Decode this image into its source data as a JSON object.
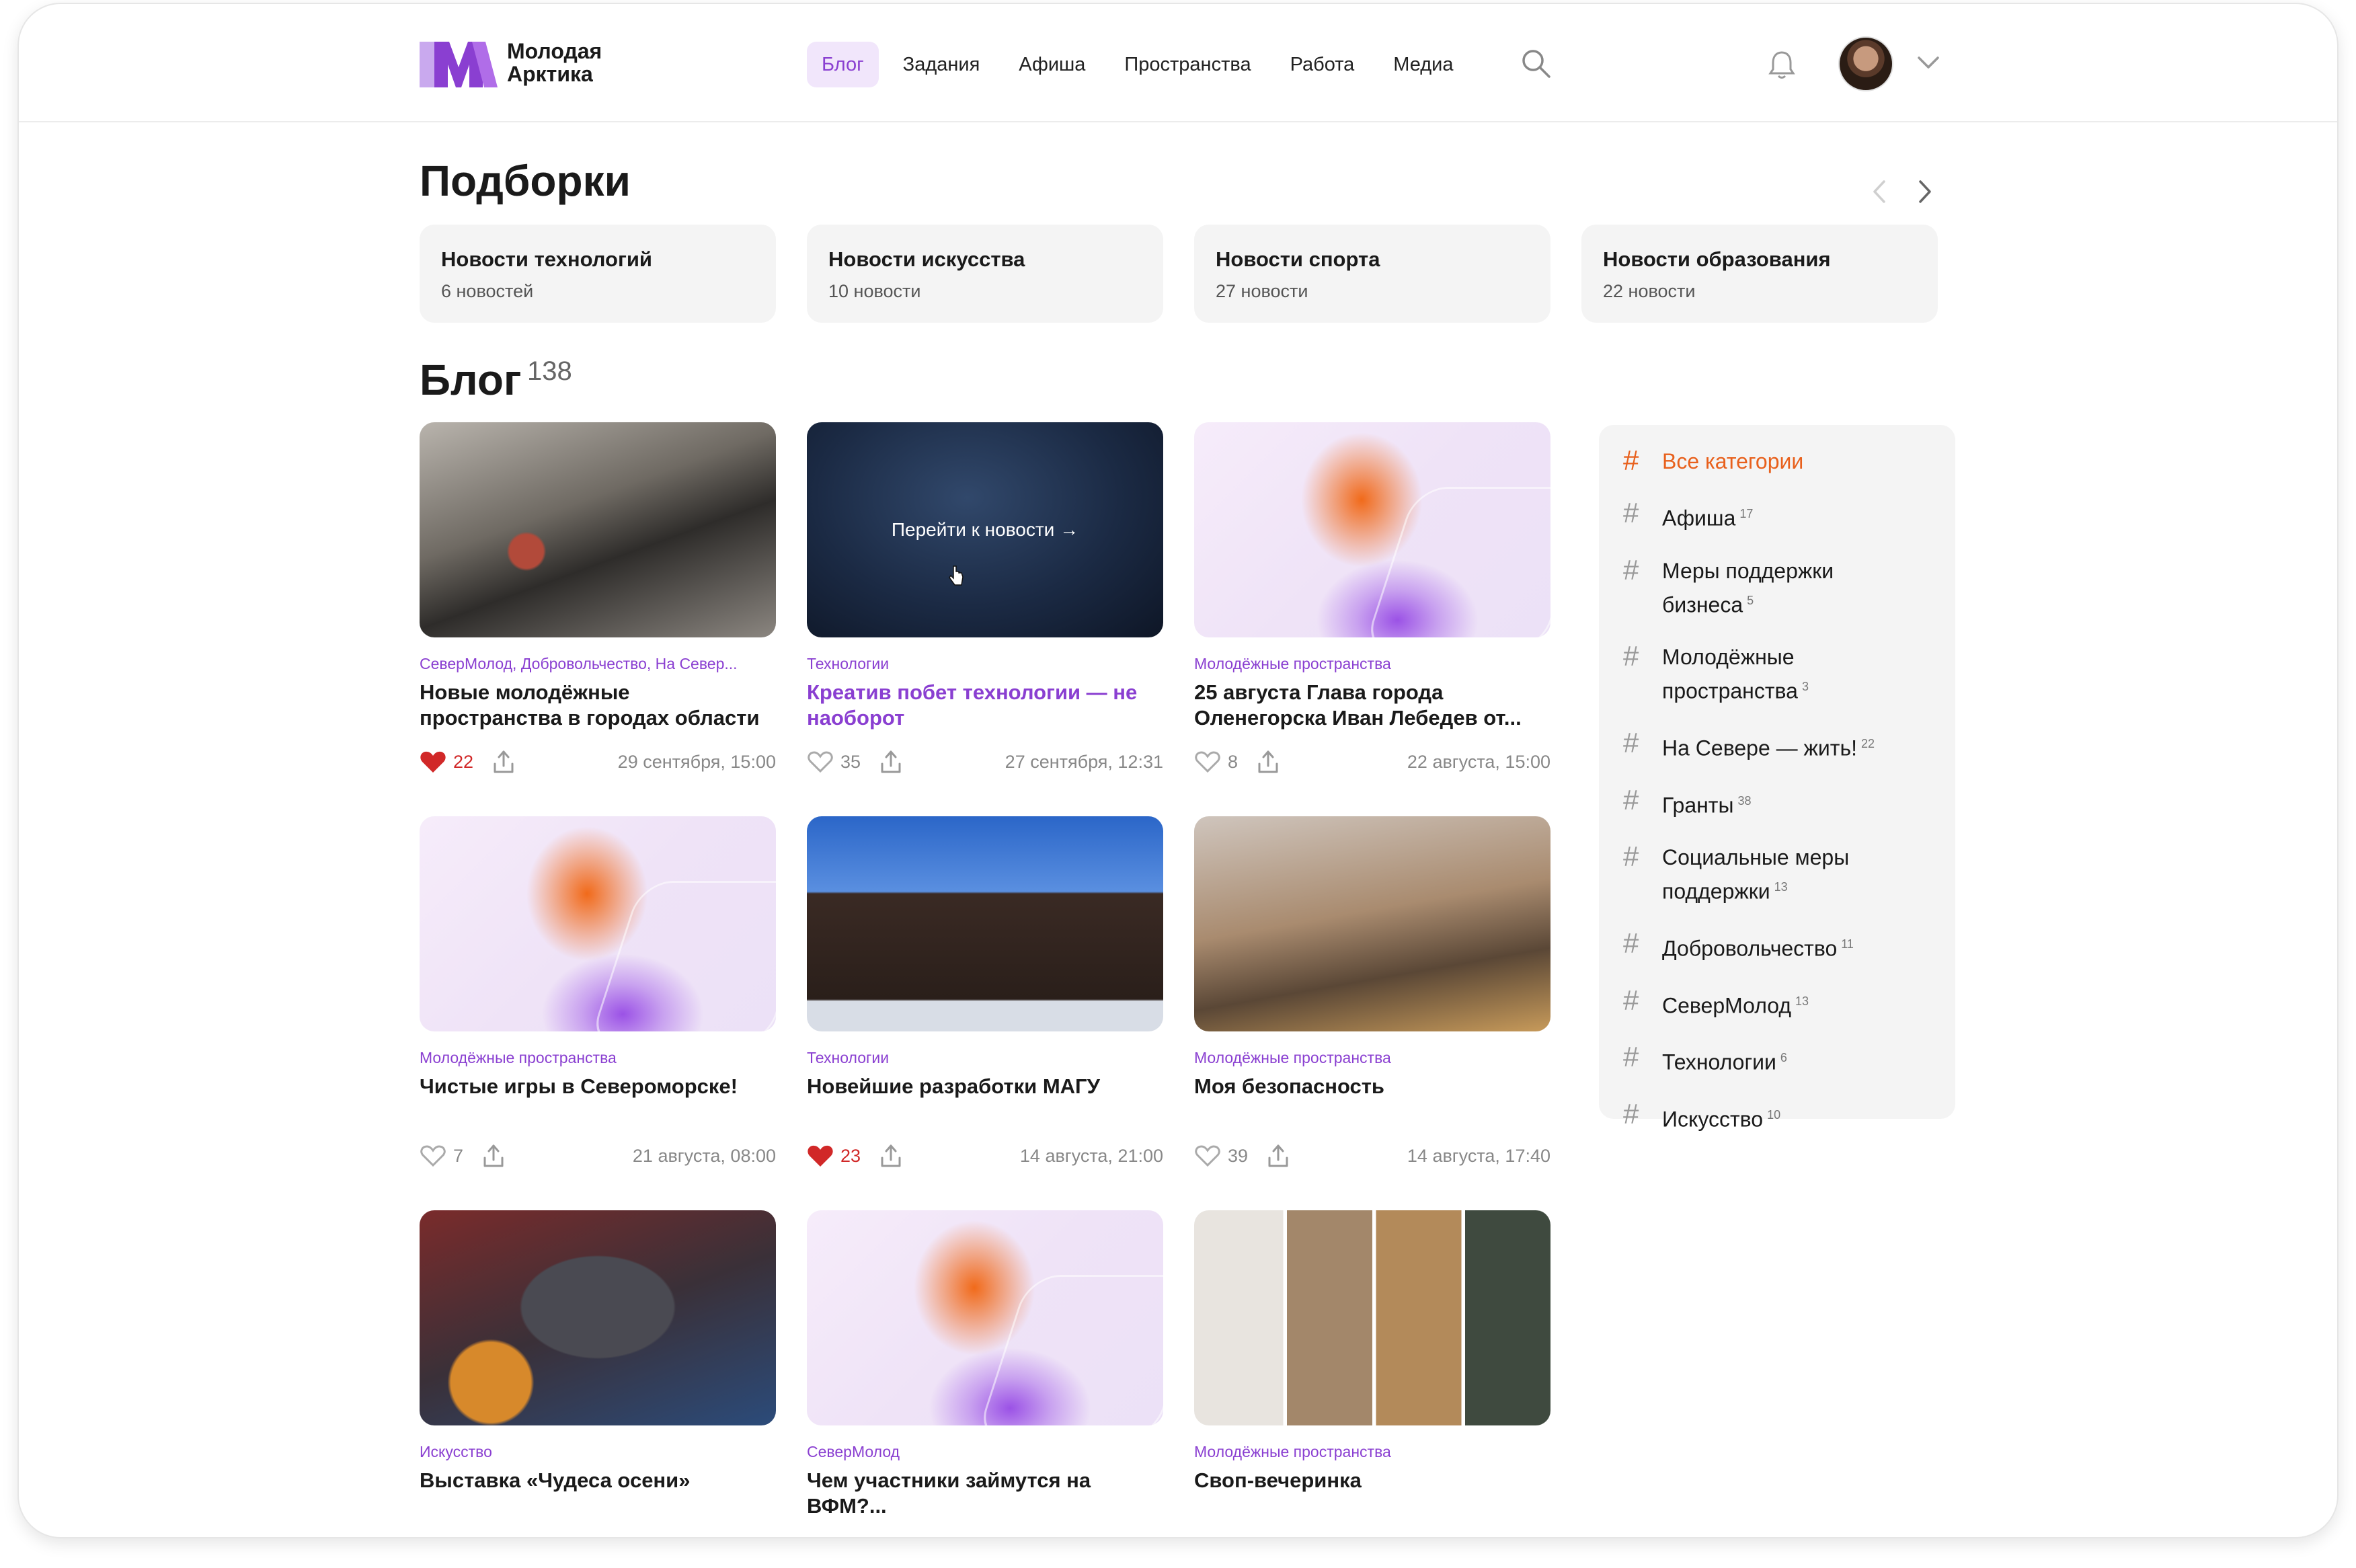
{
  "header": {
    "logo_line1": "Молодая",
    "logo_line2": "Арктика",
    "nav": [
      "Блог",
      "Задания",
      "Афиша",
      "Пространства",
      "Работа",
      "Медиа"
    ]
  },
  "collections": {
    "title": "Подборки",
    "items": [
      {
        "name": "Новости технологий",
        "count": "6 новостей"
      },
      {
        "name": "Новости искусства",
        "count": "10 новости"
      },
      {
        "name": "Новости спорта",
        "count": "27 новости"
      },
      {
        "name": "Новости образования",
        "count": "22 новости"
      }
    ]
  },
  "blog": {
    "title": "Блог",
    "count": "138",
    "hover_text": "Перейти к новости →",
    "cards": [
      {
        "tags": "СеверМолод, Добровольчество, На Север...",
        "title": "Новые молодёжные пространства в городах области",
        "likes": "22",
        "liked": true,
        "date": "29 сентября, 15:00"
      },
      {
        "tags": "Технологии",
        "title": "Креатив побет технологии — не наоборот",
        "likes": "35",
        "liked": false,
        "date": "27 сентября, 12:31"
      },
      {
        "tags": "Молодёжные пространства",
        "title": "25 августа Глава города Оленегорска Иван Лебедев от...",
        "likes": "8",
        "liked": false,
        "date": "22 августа, 15:00"
      },
      {
        "tags": "Молодёжные пространства",
        "title": "Чистые игры в Североморске!",
        "likes": "7",
        "liked": false,
        "date": "21 августа, 08:00"
      },
      {
        "tags": "Технологии",
        "title": "Новейшие разработки МАГУ",
        "likes": "23",
        "liked": true,
        "date": "14 августа, 21:00"
      },
      {
        "tags": "Молодёжные пространства",
        "title": "Моя безопасность",
        "likes": "39",
        "liked": false,
        "date": "14 августа, 17:40"
      },
      {
        "tags": "Искусство",
        "title": "Выставка «Чудеса осени»"
      },
      {
        "tags": "СеверМолод",
        "title": "Чем участники займутся на ВФМ?..."
      },
      {
        "tags": "Молодёжные пространства",
        "title": "Своп-вечеринка"
      }
    ]
  },
  "sidebar": {
    "categories": [
      {
        "name": "Все категории",
        "count": ""
      },
      {
        "name": "Афиша",
        "count": "17"
      },
      {
        "name": "Меры поддержки бизнеса",
        "count": "5"
      },
      {
        "name": "Молодёжные пространства",
        "count": "3"
      },
      {
        "name": "На Севере — жить!",
        "count": "22"
      },
      {
        "name": "Гранты",
        "count": "38"
      },
      {
        "name": "Социальные меры поддержки",
        "count": "13"
      },
      {
        "name": "Добровольчество",
        "count": "11"
      },
      {
        "name": "СеверМолод",
        "count": "13"
      },
      {
        "name": "Технологии",
        "count": "6"
      },
      {
        "name": "Искусство",
        "count": "10"
      }
    ]
  },
  "colors": {
    "accent": "#8a3fd1",
    "active_category": "#e8601c",
    "like": "#d12828"
  },
  "icons": [
    "search-icon",
    "bell-icon",
    "chevron-down-icon",
    "arrow-left-icon",
    "arrow-right-icon",
    "heart-icon",
    "share-icon",
    "hash-icon",
    "cursor-icon"
  ]
}
